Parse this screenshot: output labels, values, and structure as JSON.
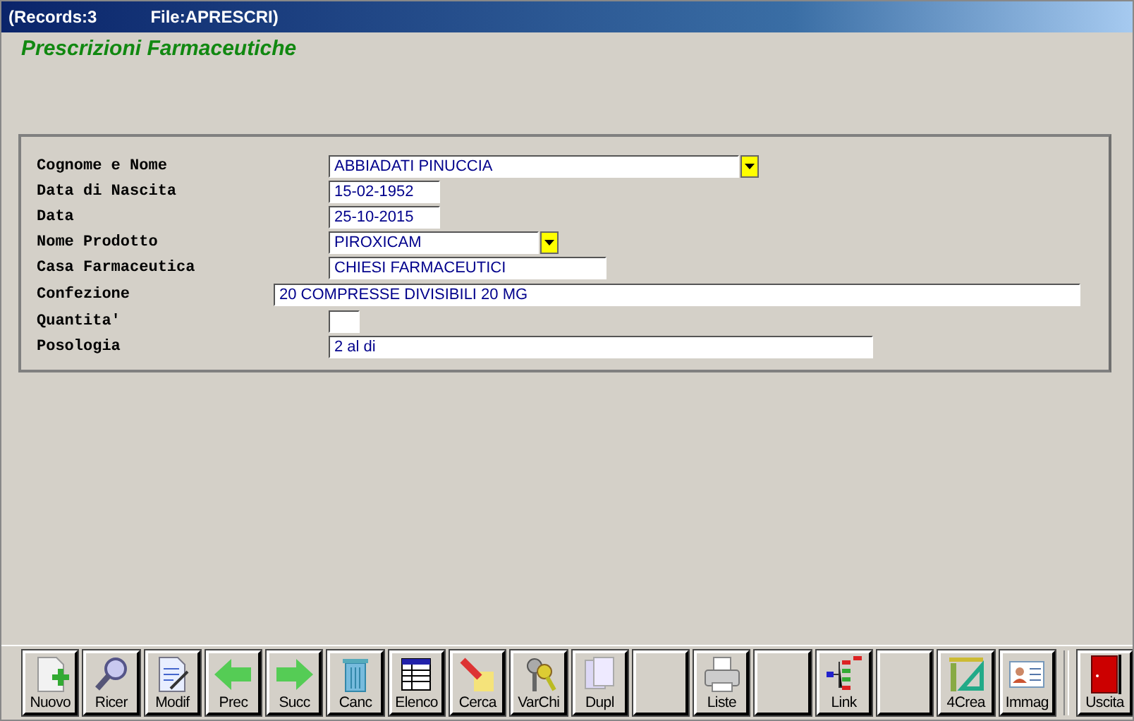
{
  "window": {
    "title_records": "(Records:3",
    "title_file": "File:APRESCRI)"
  },
  "heading": "Prescrizioni Farmaceutiche",
  "fields": [
    {
      "label": "Cognome e Nome",
      "value": "ABBIADATI PINUCCIA",
      "dropdown": true
    },
    {
      "label": "Data di Nascita",
      "value": "15-02-1952",
      "dropdown": false
    },
    {
      "label": "Data",
      "value": "25-10-2015",
      "dropdown": false
    },
    {
      "label": "Nome Prodotto",
      "value": "PIROXICAM",
      "dropdown": true
    },
    {
      "label": "Casa Farmaceutica",
      "value": "CHIESI FARMACEUTICI",
      "dropdown": false
    },
    {
      "label": "Confezione",
      "value": "20 COMPRESSE  DIVISIBILI 20 MG",
      "dropdown": false
    },
    {
      "label": "Quantita'",
      "dropdown": false
    },
    {
      "label": "Posologia",
      "value": "2 al di",
      "dropdown": false
    }
  ],
  "toolbar": [
    {
      "kind": "button",
      "label": "Nuovo"
    },
    {
      "kind": "button",
      "label": "Ricer"
    },
    {
      "kind": "button",
      "label": "Modif"
    },
    {
      "kind": "button",
      "label": "Prec"
    },
    {
      "kind": "button",
      "label": "Succ"
    },
    {
      "kind": "button",
      "label": "Canc"
    },
    {
      "kind": "button",
      "label": "Elenco"
    },
    {
      "kind": "button",
      "label": "Cerca"
    },
    {
      "kind": "button",
      "label": "VarChi"
    },
    {
      "kind": "button",
      "label": "Dupl"
    },
    {
      "kind": "blank"
    },
    {
      "kind": "button",
      "label": "Liste"
    },
    {
      "kind": "blank"
    },
    {
      "kind": "button",
      "label": "Link"
    },
    {
      "kind": "blank"
    },
    {
      "kind": "button",
      "label": "4Crea"
    },
    {
      "kind": "button",
      "label": "Immag"
    },
    {
      "kind": "separator"
    },
    {
      "kind": "button",
      "label": "Uscita"
    }
  ]
}
